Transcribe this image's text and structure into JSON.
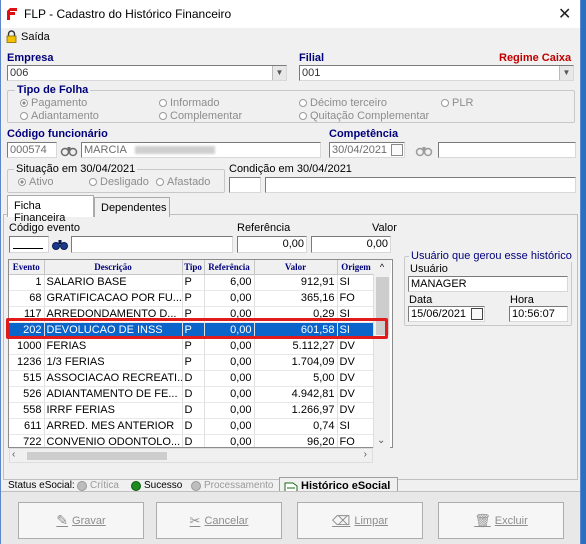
{
  "window": {
    "title": "FLP - Cadastro do Histórico Financeiro",
    "close_glyph": "✕"
  },
  "menu": {
    "exit_label": "Saída"
  },
  "empresa": {
    "label": "Empresa",
    "value": "006"
  },
  "filial": {
    "label": "Filial",
    "value": "001",
    "regime_label": "Regime Caixa"
  },
  "tipo_folha": {
    "label": "Tipo de Folha",
    "options": [
      {
        "label": "Pagamento",
        "checked": true
      },
      {
        "label": "Informado",
        "checked": false
      },
      {
        "label": "Décimo terceiro",
        "checked": false
      },
      {
        "label": "PLR",
        "checked": false
      },
      {
        "label": "Adiantamento",
        "checked": false
      },
      {
        "label": "Complementar",
        "checked": false
      },
      {
        "label": "Quitação Complementar",
        "checked": false
      }
    ]
  },
  "funcionario": {
    "label": "Código funcionário",
    "code": "000574",
    "name": "MARCIA"
  },
  "competencia": {
    "label": "Competência",
    "value": "30/04/2021"
  },
  "situacao": {
    "label": "Situação em 30/04/2021",
    "options": [
      {
        "label": "Ativo",
        "checked": true
      },
      {
        "label": "Desligado",
        "checked": false
      },
      {
        "label": "Afastado",
        "checked": false
      }
    ]
  },
  "condicao": {
    "label": "Condição em 30/04/2021"
  },
  "tabs": {
    "financeira": "Ficha Financeira",
    "dependentes": "Dependentes"
  },
  "evento_form": {
    "codigo_label": "Código evento",
    "referencia_label": "Referência",
    "referencia_value": "0,00",
    "valor_label": "Valor",
    "valor_value": "0,00"
  },
  "grid": {
    "columns": [
      "Evento",
      "Descrição",
      "Tipo",
      "Referência",
      "Valor",
      "Origem"
    ],
    "rows": [
      {
        "evento": "1",
        "descricao": "SALARIO BASE",
        "tipo": "P",
        "referencia": "6,00",
        "valor": "912,91",
        "origem": "SI",
        "selected": false
      },
      {
        "evento": "68",
        "descricao": "GRATIFICACAO POR FU...",
        "tipo": "P",
        "referencia": "0,00",
        "valor": "365,16",
        "origem": "FO",
        "selected": false
      },
      {
        "evento": "117",
        "descricao": "ARREDONDAMENTO D...",
        "tipo": "P",
        "referencia": "0,00",
        "valor": "0,29",
        "origem": "SI",
        "selected": false
      },
      {
        "evento": "202",
        "descricao": "DEVOLUCAO DE INSS",
        "tipo": "P",
        "referencia": "0,00",
        "valor": "601,58",
        "origem": "SI",
        "selected": true
      },
      {
        "evento": "1000",
        "descricao": "FERIAS",
        "tipo": "P",
        "referencia": "0,00",
        "valor": "5.112,27",
        "origem": "DV",
        "selected": false
      },
      {
        "evento": "1236",
        "descricao": "1/3 FERIAS",
        "tipo": "P",
        "referencia": "0,00",
        "valor": "1.704,09",
        "origem": "DV",
        "selected": false
      },
      {
        "evento": "515",
        "descricao": "ASSOCIACAO RECREATI...",
        "tipo": "D",
        "referencia": "0,00",
        "valor": "5,00",
        "origem": "DV",
        "selected": false
      },
      {
        "evento": "526",
        "descricao": "ADIANTAMENTO DE FE...",
        "tipo": "D",
        "referencia": "0,00",
        "valor": "4.942,81",
        "origem": "DV",
        "selected": false
      },
      {
        "evento": "558",
        "descricao": "IRRF FERIAS",
        "tipo": "D",
        "referencia": "0,00",
        "valor": "1.266,97",
        "origem": "DV",
        "selected": false
      },
      {
        "evento": "611",
        "descricao": "ARRED. MES ANTERIOR",
        "tipo": "D",
        "referencia": "0,00",
        "valor": "0,74",
        "origem": "SI",
        "selected": false
      },
      {
        "evento": "722",
        "descricao": "CONVENIO ODONTOLO...",
        "tipo": "D",
        "referencia": "0,00",
        "valor": "96,20",
        "origem": "FO",
        "selected": false
      }
    ]
  },
  "usuario_box": {
    "title": "Usuário que gerou esse histórico",
    "usuario_label": "Usuário",
    "usuario_value": "MANAGER",
    "data_label": "Data",
    "data_value": "15/06/2021",
    "hora_label": "Hora",
    "hora_value": "10:56:07"
  },
  "status": {
    "label": "Status eSocial:",
    "critica": "Crítica",
    "sucesso": "Sucesso",
    "processamento": "Processamento",
    "historico_btn": "Histórico eSocial"
  },
  "buttons": {
    "gravar": "Gravar",
    "cancelar": "Cancelar",
    "limpar": "Limpar",
    "excluir": "Excluir"
  },
  "colors": {
    "selection": "#0a64c9",
    "highlight_border": "#e11b1b",
    "label_blue": "#00007b",
    "regime_red": "#c00000"
  }
}
